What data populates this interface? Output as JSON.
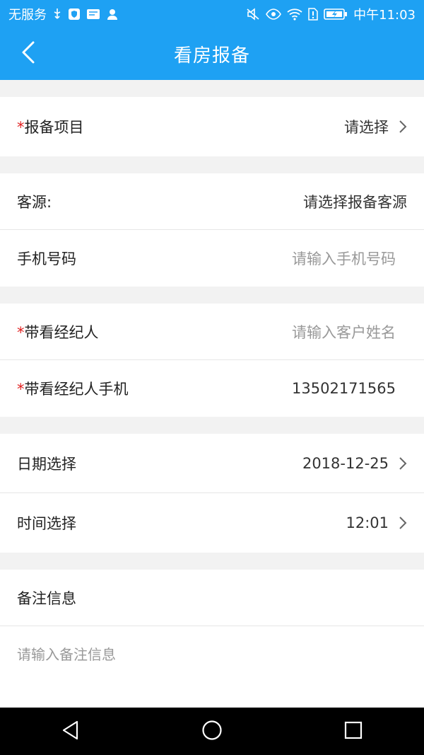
{
  "status_bar": {
    "carrier": "无服务",
    "time": "中午11:03",
    "icons": [
      "usb-icon",
      "shield-icon",
      "hms-icon",
      "person-icon",
      "mute-icon",
      "eye-icon",
      "wifi-icon",
      "sim-alert-icon",
      "battery-icon"
    ]
  },
  "header": {
    "title": "看房报备"
  },
  "form": {
    "project": {
      "label": "报备项目",
      "required_mark": "*",
      "value": "请选择"
    },
    "customer": {
      "label": "客源:",
      "value": "请选择报备客源"
    },
    "phone": {
      "label": "手机号码",
      "placeholder": "请输入手机号码"
    },
    "agent": {
      "label": "带看经纪人",
      "required_mark": "*",
      "placeholder": "请输入客户姓名"
    },
    "agent_phone": {
      "label": "带看经纪人手机",
      "required_mark": "*",
      "value": "13502171565"
    },
    "date": {
      "label": "日期选择",
      "value": "2018-12-25"
    },
    "time": {
      "label": "时间选择",
      "value": "12:01"
    },
    "memo": {
      "label": "备注信息",
      "placeholder": "请输入备注信息"
    }
  },
  "colors": {
    "accent": "#1ea1f3",
    "required": "#e02020"
  }
}
